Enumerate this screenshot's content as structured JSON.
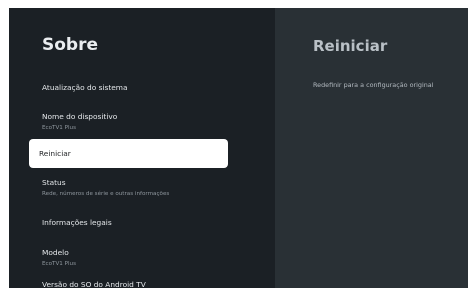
{
  "left_panel": {
    "title": "Sobre",
    "items": [
      {
        "label": "Atualização do sistema"
      },
      {
        "label": "Nome do dispositivo",
        "sub": "EcoTV1 Plus"
      },
      {
        "label": "Reiniciar",
        "selected": true
      },
      {
        "label": "Status",
        "sub": "Rede, números de série e outras informações"
      },
      {
        "label": "Informações legais"
      },
      {
        "label": "Modelo",
        "sub": "EcoTV1 Plus"
      },
      {
        "label": "Versão do SO do Android TV"
      }
    ]
  },
  "right_panel": {
    "title": "Reiniciar",
    "items": [
      {
        "label": "Redefinir para a configuração original"
      }
    ]
  },
  "colors": {
    "left_background": "#1b2025",
    "right_background": "#293035",
    "selected_background": "#ffffff"
  }
}
